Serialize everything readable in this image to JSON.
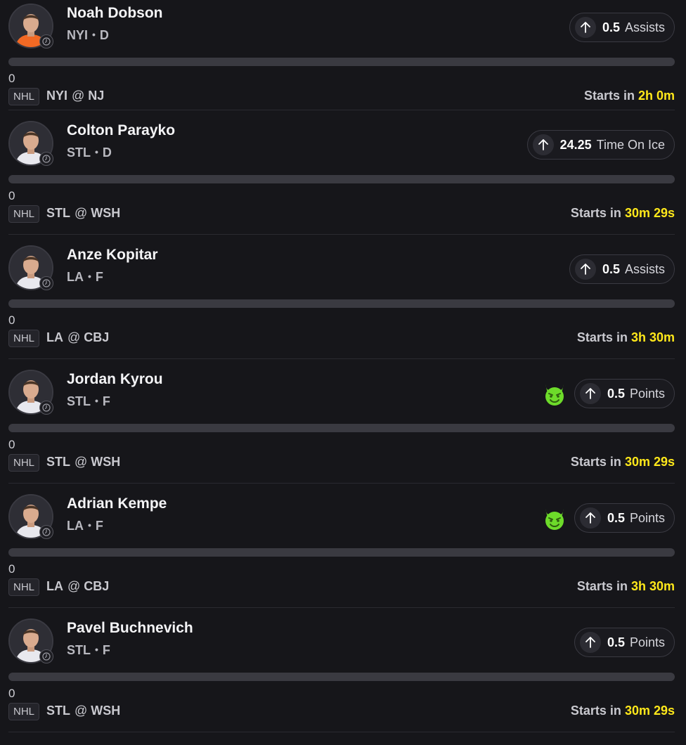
{
  "colors": {
    "background": "#16161a",
    "countdown_accent": "#ffe81a",
    "demon_green": "#6ddb2a",
    "progress_track": "#3a3a41"
  },
  "cards": [
    {
      "name": "Noah Dobson",
      "team": "NYI",
      "position": "D",
      "line_direction_icon": "arrow-up-icon",
      "line_value": "0.5",
      "line_stat": "Assists",
      "has_demon": false,
      "progress_value": "0",
      "progress_fraction": 0,
      "league": "NHL",
      "away_team": "NYI",
      "at": "@",
      "home_team": "NJ",
      "starts_label": "Starts in",
      "countdown": "2h 0m",
      "jersey_color": "#f26924"
    },
    {
      "name": "Colton Parayko",
      "team": "STL",
      "position": "D",
      "line_direction_icon": "arrow-up-icon",
      "line_value": "24.25",
      "line_stat": "Time On Ice",
      "has_demon": false,
      "progress_value": "0",
      "progress_fraction": 0,
      "league": "NHL",
      "away_team": "STL",
      "at": "@",
      "home_team": "WSH",
      "starts_label": "Starts in",
      "countdown": "30m 29s",
      "jersey_color": "#e8e8ee"
    },
    {
      "name": "Anze Kopitar",
      "team": "LA",
      "position": "F",
      "line_direction_icon": "arrow-up-icon",
      "line_value": "0.5",
      "line_stat": "Assists",
      "has_demon": false,
      "progress_value": "0",
      "progress_fraction": 0,
      "league": "NHL",
      "away_team": "LA",
      "at": "@",
      "home_team": "CBJ",
      "starts_label": "Starts in",
      "countdown": "3h 30m",
      "jersey_color": "#e8e8ee"
    },
    {
      "name": "Jordan Kyrou",
      "team": "STL",
      "position": "F",
      "line_direction_icon": "arrow-up-icon",
      "line_value": "0.5",
      "line_stat": "Points",
      "has_demon": true,
      "progress_value": "0",
      "progress_fraction": 0,
      "league": "NHL",
      "away_team": "STL",
      "at": "@",
      "home_team": "WSH",
      "starts_label": "Starts in",
      "countdown": "30m 29s",
      "jersey_color": "#e8e8ee"
    },
    {
      "name": "Adrian Kempe",
      "team": "LA",
      "position": "F",
      "line_direction_icon": "arrow-up-icon",
      "line_value": "0.5",
      "line_stat": "Points",
      "has_demon": true,
      "progress_value": "0",
      "progress_fraction": 0,
      "league": "NHL",
      "away_team": "LA",
      "at": "@",
      "home_team": "CBJ",
      "starts_label": "Starts in",
      "countdown": "3h 30m",
      "jersey_color": "#e8e8ee"
    },
    {
      "name": "Pavel Buchnevich",
      "team": "STL",
      "position": "F",
      "line_direction_icon": "arrow-up-icon",
      "line_value": "0.5",
      "line_stat": "Points",
      "has_demon": false,
      "progress_value": "0",
      "progress_fraction": 0,
      "league": "NHL",
      "away_team": "STL",
      "at": "@",
      "home_team": "WSH",
      "starts_label": "Starts in",
      "countdown": "30m 29s",
      "jersey_color": "#e8e8ee"
    }
  ]
}
